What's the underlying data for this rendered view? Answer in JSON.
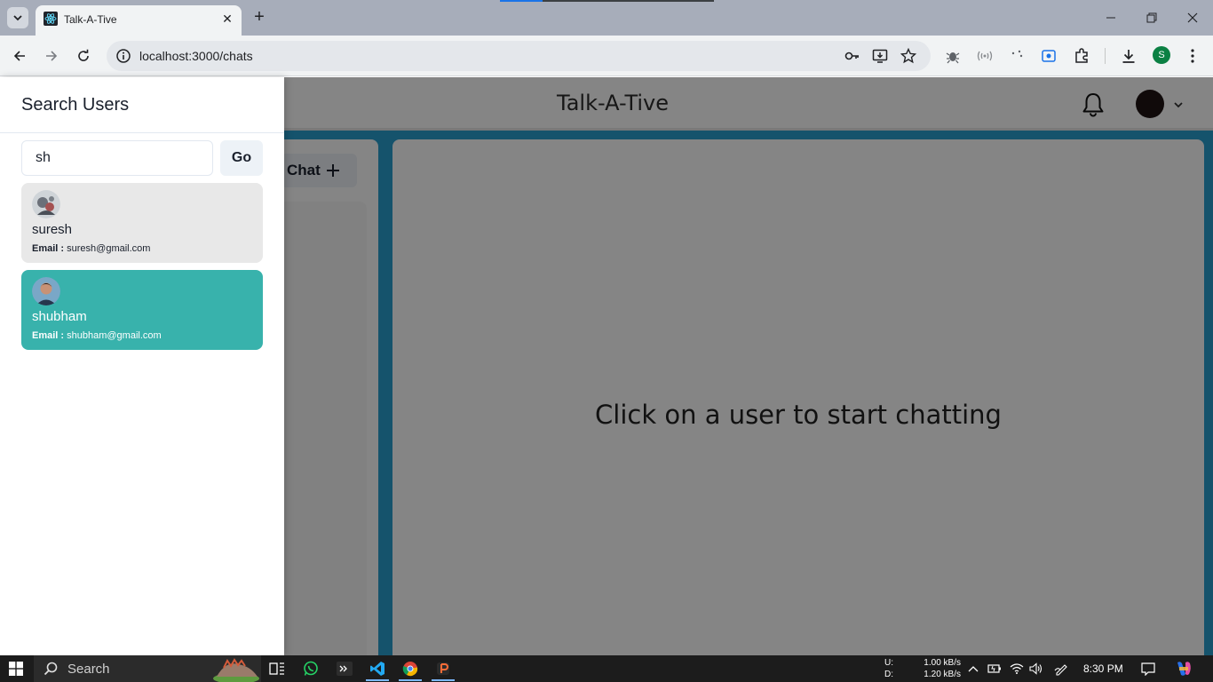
{
  "browser": {
    "tab_title": "Talk-A-Tive",
    "url": "localhost:3000/chats",
    "profile_initial": "S"
  },
  "app": {
    "brand": "Talk-A-Tive",
    "new_chat_label": "Chat",
    "empty_message": "Click on a user to start chatting"
  },
  "drawer": {
    "title": "Search Users",
    "search_value": "sh",
    "go_label": "Go",
    "email_prefix": "Email :",
    "results": [
      {
        "name": "suresh",
        "email": "suresh@gmail.com"
      },
      {
        "name": "shubham",
        "email": "shubham@gmail.com"
      }
    ]
  },
  "taskbar": {
    "search_label": "Search",
    "upload_label": "U:",
    "download_label": "D:",
    "upload_speed": "1.00 kB/s",
    "download_speed": "1.20 kB/s",
    "time": "8:30 PM"
  },
  "colors": {
    "selected_result": "#38b2ac",
    "app_background": "#2a9fd0",
    "chrome_tabstrip": "#a7adba"
  }
}
